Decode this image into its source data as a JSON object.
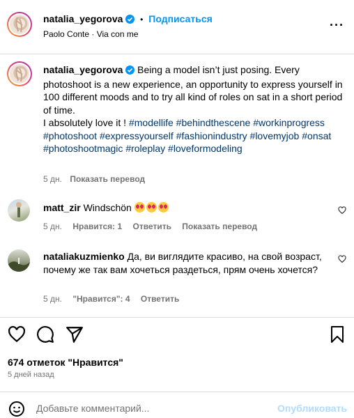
{
  "header": {
    "username": "natalia_yegorova",
    "follow_label": "Подписаться",
    "dot": "•",
    "audio": "Paolo Conte · Via con me",
    "more": "···"
  },
  "caption": {
    "username": "natalia_yegorova",
    "text": "Being a model isn’t just posing. Every photoshoot is a new experience, an opportunity to express yourself in 100 different moods and to try all kind of roles on sat in a short period of time.",
    "line2": "I absolutely love it ! ",
    "tags": [
      "#modellife",
      "#behindthescene",
      "#workinprogress",
      "#photoshoot",
      "#expressyourself",
      "#fashionindustry",
      "#lovemyjob",
      "#onsat",
      "#photoshootmagic",
      "#roleplay",
      "#loveformodeling"
    ],
    "time": "5 дн.",
    "translate": "Показать перевод"
  },
  "comments": [
    {
      "username": "matt_zir",
      "text": "Windschön",
      "emoji_count": 3,
      "time": "5 дн.",
      "likes": "Нравится: 1",
      "reply": "Ответить",
      "translate": "Показать перевод"
    },
    {
      "username": "nataliakuzmienko",
      "text": "Да, ви виглядите красиво, на свой возраст, почему же так вам хочеться раздеться, прям очень хочется?",
      "time": "5 дн.",
      "likes": "\"Нравится\": 4",
      "reply": "Ответить"
    }
  ],
  "footer": {
    "likes": "674 отметок \"Нравится\"",
    "ago": "5 дней назад",
    "add_comment_placeholder": "Добавьте комментарий...",
    "publish": "Опубликовать"
  },
  "colors": {
    "link_blue": "#0095f6",
    "hashtag": "#00376b",
    "muted": "#737373",
    "border": "#dbdbdb",
    "verified": "#0095f6"
  }
}
